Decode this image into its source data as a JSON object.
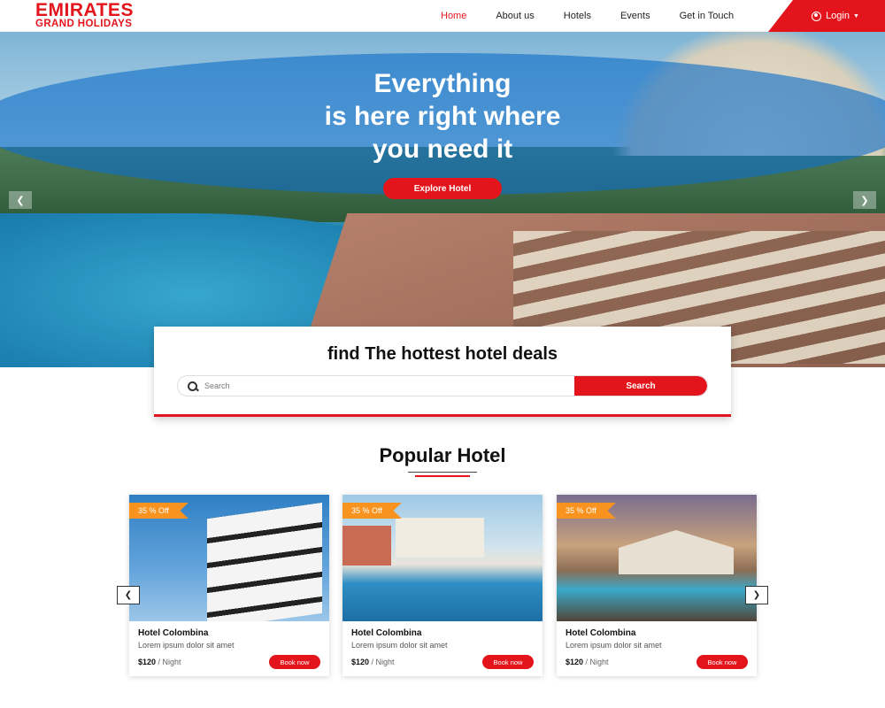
{
  "brand": {
    "line1": "EMIRATES",
    "line2": "GRAND HOLIDAYS"
  },
  "nav": {
    "items": [
      {
        "label": "Home",
        "active": true
      },
      {
        "label": "About us"
      },
      {
        "label": "Hotels"
      },
      {
        "label": "Events"
      },
      {
        "label": "Get in Touch"
      }
    ],
    "login_label": "Login"
  },
  "hero": {
    "title_line1": "Everything",
    "title_line2": "is here right where",
    "title_line3": "you need it",
    "cta_label": "Explore Hotel",
    "prev_icon": "chevron-left-icon",
    "next_icon": "chevron-right-icon"
  },
  "deals": {
    "title": "find The hottest hotel deals",
    "search_placeholder": "Search",
    "search_button": "Search"
  },
  "popular": {
    "title": "Popular Hotel",
    "cards": [
      {
        "badge": "35 % Off",
        "name": "Hotel Colombina",
        "desc": "Lorem ipsum dolor sit amet",
        "price": "$120",
        "unit": " / Night",
        "book": "Book now"
      },
      {
        "badge": "35 % Off",
        "name": "Hotel Colombina",
        "desc": "Lorem ipsum dolor sit amet",
        "price": "$120",
        "unit": " / Night",
        "book": "Book now"
      },
      {
        "badge": "35 % Off",
        "name": "Hotel Colombina",
        "desc": "Lorem ipsum dolor sit amet",
        "price": "$120",
        "unit": " / Night",
        "book": "Book now"
      }
    ]
  },
  "colors": {
    "accent": "#e3141b",
    "badge": "#f7931e",
    "overlay": "#0e6ec8"
  }
}
